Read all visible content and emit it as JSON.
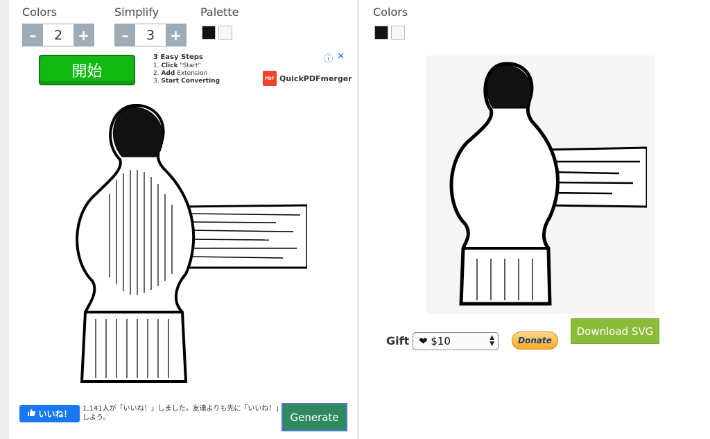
{
  "left": {
    "colors": {
      "label": "Colors",
      "minus": "–",
      "plus": "+",
      "value": "2"
    },
    "simplify": {
      "label": "Simplify",
      "minus": "–",
      "plus": "+",
      "value": "3"
    },
    "palette": {
      "label": "Palette",
      "swatches": [
        "#111111",
        "#f7f7f7"
      ]
    },
    "ad": {
      "start_label": "開始",
      "steps_title": "3 Easy Steps",
      "step1_pre": "1. ",
      "step1_bold": "Click",
      "step1_post": " \"Start\"",
      "step2_pre": "2. ",
      "step2_bold": "Add",
      "step2_post": " Extension",
      "step3_pre": "3. ",
      "step3_bold": "Start Converting",
      "brand": "QuickPDFmerger",
      "brand_icon": "PDF",
      "info_icon": "ⓘ",
      "close_icon": "✕"
    },
    "like": {
      "button_label": "いいね！",
      "text": "1,141人が「いいね！」しました。友達よりも先に「いいね！」しよう。"
    },
    "generate_label": "Generate"
  },
  "right": {
    "colors_label": "Colors",
    "swatches": [
      "#111111",
      "#f7f7f7"
    ],
    "gift_label": "Gift",
    "gift_value": "❤ $10",
    "donate_label": "Donate",
    "download_label": "Download SVG"
  },
  "colors": {
    "accent_green": "#2e8a5e",
    "download_green": "#8cbb3a",
    "stepper": "#9eacb8",
    "facebook": "#1877f2"
  }
}
